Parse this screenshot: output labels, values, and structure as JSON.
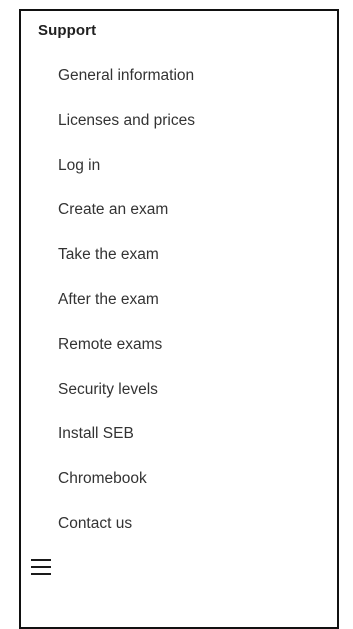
{
  "sidebar": {
    "section_title": "Support",
    "items": [
      {
        "label": "General information"
      },
      {
        "label": "Licenses and prices"
      },
      {
        "label": "Log in"
      },
      {
        "label": "Create an exam"
      },
      {
        "label": "Take the exam"
      },
      {
        "label": "After the exam"
      },
      {
        "label": "Remote exams"
      },
      {
        "label": "Security levels"
      },
      {
        "label": "Install SEB"
      },
      {
        "label": "Chromebook"
      },
      {
        "label": "Contact us"
      }
    ],
    "menu_icon": "hamburger-menu-icon"
  }
}
